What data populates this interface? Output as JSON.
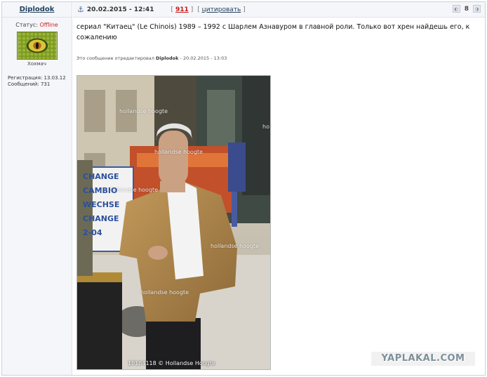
{
  "user": {
    "name": "Diplodok",
    "status_label": "Статус:",
    "status_value": "Offline",
    "avatar_caption": "Хохмач",
    "registered_label": "Регистрация:",
    "registered_value": "13.03.12",
    "messages_label": "Сообщений:",
    "messages_value": "731"
  },
  "post": {
    "date": "20.02.2015 - 12:41",
    "karma": "911",
    "quote_label": "цитировать",
    "rating": "8",
    "text": "сериал \"Китаец\" (Le Chinois) 1989 – 1992 с Шарлем Азнавуром в главной роли. Только вот хрен найдешь его, к сожалению",
    "edited_prefix": "Это сообщение отредактировал",
    "edited_by": "Diplodok",
    "edited_date": "- 20.02.2015 - 13:03"
  },
  "photo": {
    "watermark": "hollandse hoogte",
    "watermark_short": "ho",
    "caption": "18184118 © Hollandse Hoogte",
    "sign_line1": "CHANGE",
    "sign_line2": "CAMBIO",
    "sign_line3": "WECHSE",
    "sign_line4": "CHANGE",
    "sign_line5": "2-04"
  },
  "site_watermark": "YAPLAKAL.COM",
  "colors": {
    "status_offline": "#cc2222",
    "karma": "#c21a1a",
    "link": "#23415f"
  }
}
